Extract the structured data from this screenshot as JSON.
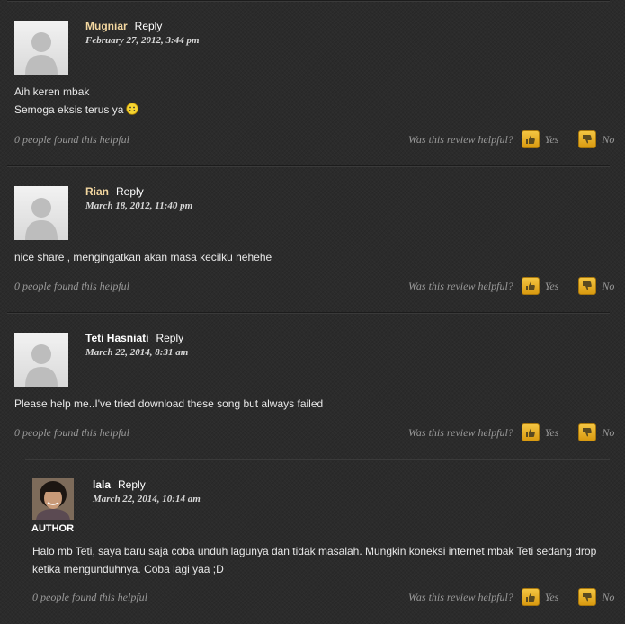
{
  "comments": [
    {
      "name": "Mugniar",
      "reply": "Reply",
      "date": "February 27, 2012, 3:44 pm",
      "lines": [
        "Aih keren mbak",
        "Semoga eksis terus ya"
      ],
      "helpful": "0 people found this helpful",
      "question": "Was this review helpful?",
      "yes": "Yes",
      "no": "No"
    },
    {
      "name": "Rian",
      "reply": "Reply",
      "date": "March 18, 2012, 11:40 pm",
      "lines": [
        "nice share , mengingatkan akan masa kecilku hehehe"
      ],
      "helpful": "0 people found this helpful",
      "question": "Was this review helpful?",
      "yes": "Yes",
      "no": "No"
    },
    {
      "name": "Teti Hasniati",
      "reply": "Reply",
      "date": "March 22, 2014, 8:31 am",
      "lines": [
        "Please help me..I've tried download these song but always failed"
      ],
      "helpful": "0 people found this helpful",
      "question": "Was this review helpful?",
      "yes": "Yes",
      "no": "No"
    },
    {
      "name": "lala",
      "reply": "Reply",
      "date": "March 22, 2014, 10:14 am",
      "author_tag": "AUTHOR",
      "lines": [
        "Halo mb Teti, saya baru saja coba unduh lagunya dan tidak masalah. Mungkin koneksi internet mbak Teti sedang drop",
        "ketika mengunduhnya. Coba lagi yaa ;D"
      ],
      "helpful": "0 people found this helpful",
      "question": "Was this review helpful?",
      "yes": "Yes",
      "no": "No"
    }
  ],
  "colors": {
    "background": "#2b2b2b",
    "highlight_name": "#f3d7a0",
    "thumb_button": "#e8b020"
  },
  "icons": [
    "default-avatar-icon",
    "smiley-icon",
    "thumbs-up-icon",
    "thumbs-down-icon"
  ]
}
